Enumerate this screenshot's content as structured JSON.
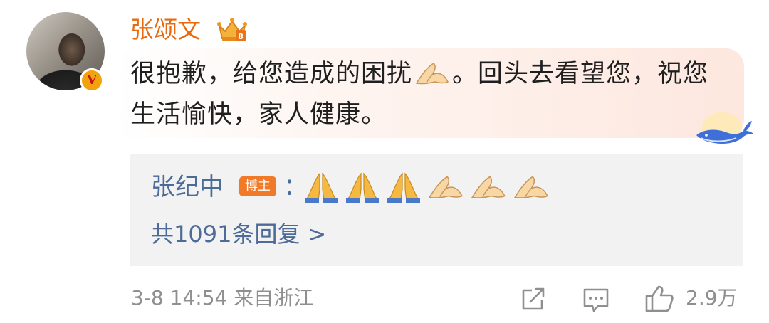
{
  "comment": {
    "username": "张颂文",
    "avatar_badge": "V",
    "user_badge_icon": "crown-level-icon",
    "text_before_emoji": "很抱歉，给您造成的困扰",
    "inline_emoji": "folded-hands-light-icon",
    "text_after_emoji": "。回头去看望您，祝您生活愉快，家人健康。",
    "decoration_icon": "whale-icon"
  },
  "reply": {
    "name": "张纪中",
    "tag": "博主",
    "colon": "：",
    "emojis": [
      "folded-hands-icon",
      "folded-hands-icon",
      "folded-hands-icon",
      "folded-hands-light-icon",
      "folded-hands-light-icon",
      "folded-hands-light-icon"
    ],
    "count_text": "共1091条回复 >"
  },
  "footer": {
    "time": "3-8 14:54",
    "location": "来自浙江",
    "like_count": "2.9万",
    "share_icon": "share-icon",
    "comment_icon": "comment-icon",
    "like_icon": "thumbs-up-icon"
  },
  "colors": {
    "username": "#e8690e",
    "reply_link": "#4c6b96",
    "tag_bg": "#f07a28",
    "meta": "#8f8f8f"
  }
}
